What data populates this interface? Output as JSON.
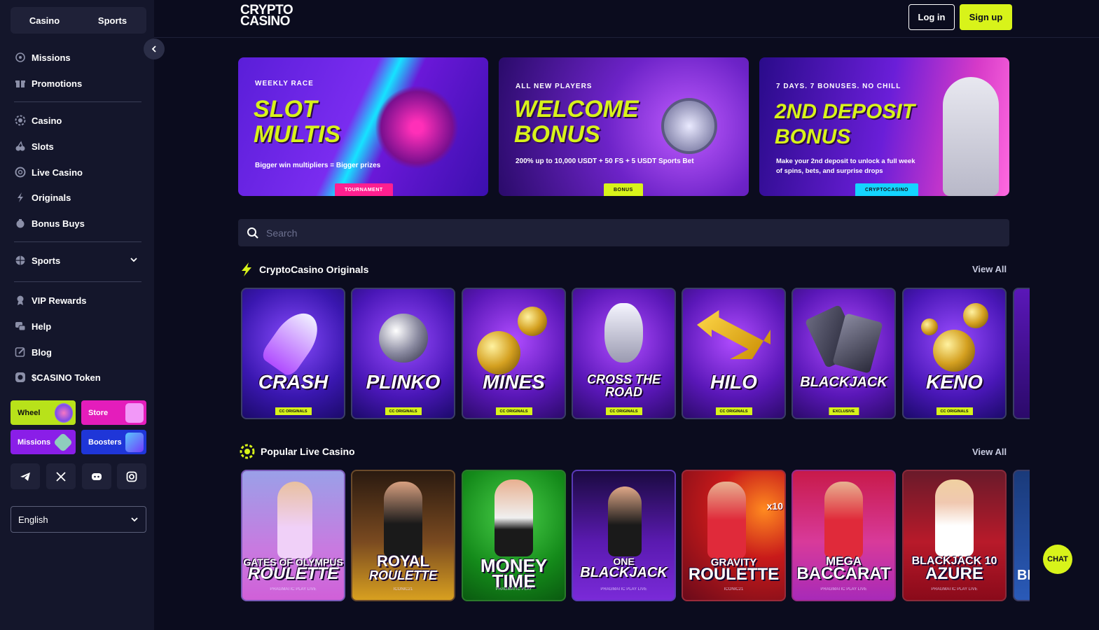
{
  "sidebar": {
    "modes": [
      "Casino",
      "Sports"
    ],
    "nav": {
      "missions": "Missions",
      "promotions": "Promotions",
      "casino": "Casino",
      "slots": "Slots",
      "live_casino": "Live Casino",
      "originals": "Originals",
      "bonus_buys": "Bonus Buys",
      "sports": "Sports",
      "vip_rewards": "VIP Rewards",
      "help": "Help",
      "blog": "Blog",
      "token": "$CASINO Token"
    },
    "tiles": {
      "wheel": "Wheel",
      "store": "Store",
      "missions": "Missions",
      "boosters": "Boosters"
    },
    "social_icons": [
      "telegram-icon",
      "x-icon",
      "discord-icon",
      "instagram-icon"
    ],
    "language": "English"
  },
  "header": {
    "logo_line1": "CRYPTO",
    "logo_line2": "CASINO",
    "login": "Log in",
    "signup": "Sign up"
  },
  "banners": [
    {
      "kicker": "WEEKLY RACE",
      "line1": "SLOT",
      "line2": "MULTIS",
      "desc": "Bigger win multipliers = Bigger prizes",
      "tag": "TOURNAMENT"
    },
    {
      "kicker": "ALL NEW PLAYERS",
      "line1": "WELCOME",
      "line2": "BONUS",
      "desc": "200% up to 10,000 USDT + 50 FS + 5 USDT Sports Bet",
      "tag": "BONUS"
    },
    {
      "kicker": "7 DAYS. 7 BONUSES. NO CHILL",
      "line1": "2ND DEPOSIT",
      "line2": "BONUS",
      "desc": "Make your 2nd deposit to unlock a full week of spins, bets, and surprise drops",
      "tag": "CRYPTOCASINO"
    }
  ],
  "search": {
    "placeholder": "Search"
  },
  "originals": {
    "title": "CryptoCasino Originals",
    "view_all": "View All",
    "games": [
      {
        "name": "CRASH",
        "badge": "CC ORIGINALS"
      },
      {
        "name": "PLINKO",
        "badge": "CC ORIGINALS"
      },
      {
        "name": "MINES",
        "badge": "CC ORIGINALS"
      },
      {
        "name": "CROSS THE ROAD",
        "badge": "CC ORIGINALS"
      },
      {
        "name": "HILO",
        "badge": "CC ORIGINALS"
      },
      {
        "name": "BLACKJACK",
        "badge": "EXCLUSIVE"
      },
      {
        "name": "KENO",
        "badge": "CC ORIGINALS"
      }
    ]
  },
  "live": {
    "title": "Popular Live Casino",
    "view_all": "View All",
    "games": [
      {
        "line1": "GATES OF OLYMPUS",
        "line2": "ROULETTE",
        "provider": "PRAGMATIC PLAY LIVE"
      },
      {
        "line1": "ROYAL",
        "line2": "ROULETTE",
        "provider": "ICONIC21"
      },
      {
        "line1": "",
        "line2": "MONEY TIME",
        "provider": "PRAGMATIC PLAY"
      },
      {
        "line1": "ONE",
        "line2": "BLACKJACK",
        "provider": "PRAGMATIC PLAY LIVE"
      },
      {
        "line1": "GRAVITY",
        "line2": "ROULETTE",
        "provider": "ICONIC21"
      },
      {
        "line1": "MEGA",
        "line2": "BACCARAT",
        "provider": "PRAGMATIC PLAY LIVE"
      },
      {
        "line1": "BLACKJACK 10",
        "line2": "AZURE",
        "provider": "PRAGMATIC PLAY LIVE"
      }
    ],
    "peek_text": "BI",
    "gravity_multiplier": "x10"
  },
  "chat": "CHAT",
  "colors": {
    "accent": "#d8f31a",
    "bg": "#0b0c1e",
    "sidebar": "#14162b"
  }
}
